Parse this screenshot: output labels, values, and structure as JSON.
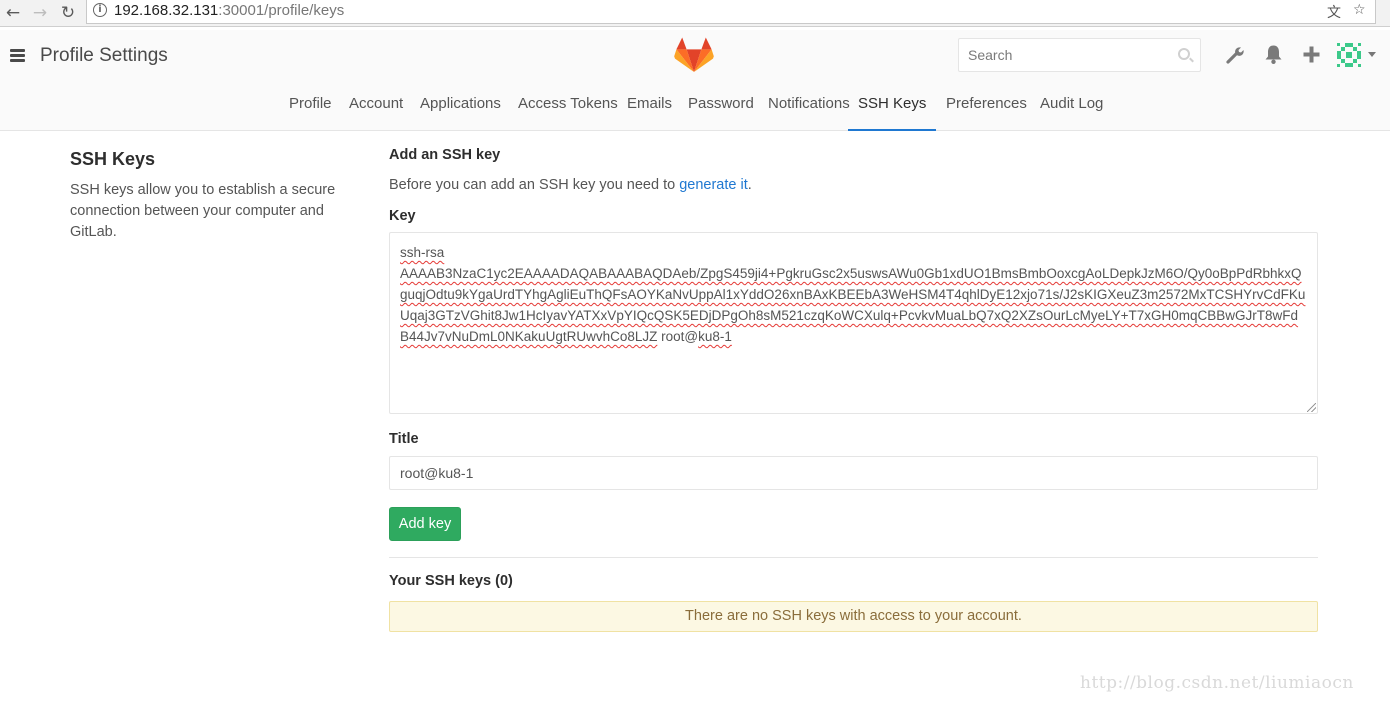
{
  "browser": {
    "url_host": "192.168.32.131",
    "url_path": ":30001/profile/keys",
    "back_icon": "arrow-left-icon",
    "forward_icon": "arrow-right-icon",
    "reload_icon": "reload-icon"
  },
  "header": {
    "title": "Profile Settings",
    "search_placeholder": "Search",
    "icons": [
      "hamburger-icon",
      "gitlab-logo",
      "search-icon",
      "wrench-icon",
      "bell-icon",
      "plus-icon",
      "avatar"
    ],
    "brand_color": "#fc6d26"
  },
  "subnav": {
    "items": [
      {
        "label": "Profile"
      },
      {
        "label": "Account"
      },
      {
        "label": "Applications"
      },
      {
        "label": "Access Tokens"
      },
      {
        "label": "Emails"
      },
      {
        "label": "Password"
      },
      {
        "label": "Notifications"
      },
      {
        "label": "SSH Keys",
        "active": true
      },
      {
        "label": "Preferences"
      },
      {
        "label": "Audit Log"
      }
    ],
    "active_color": "#1f78d1"
  },
  "sidebar": {
    "title": "SSH Keys",
    "description": "SSH keys allow you to establish a secure connection between your computer and GitLab."
  },
  "form": {
    "heading": "Add an SSH key",
    "intro_before": "Before you can add an SSH key you need to ",
    "intro_link": "generate it",
    "intro_after": ".",
    "key_label": "Key",
    "key_value": "ssh-rsa AAAAB3NzaC1yc2EAAAADAQABAAABAQDAeb/ZpgS459ji4+PgkruGsc2x5uswsAWu0Gb1xdUO1BmsBmbOoxcgAoLDepkJzM6O/Qy0oBpPdRbhkxQguqjOdtu9kYgaUrdTYhgAgliEuThQFsAOYKaNvUppAl1xYddO26xnBAxKBEEbA3WeHSM4T4qhlDyE12xjo71s/J2sKIGXeuZ3m2572MxTCSHYrvCdFKuUqaj3GTzVGhit8Jw1HcIyavYATXxVpYIQcQSK5EDjDPgOh8sM521czqKoWCXulq+PcvkvMuaLbQ7xQ2XZsOurLcMyeLY+T7xGH0mqCBBwGJrT8wFdB44Jv7vNuDmL0NKakuUgtRUwvhCo8LJZ root@ku8-1",
    "title_label": "Title",
    "title_value": "root@ku8-1",
    "submit_label": "Add key",
    "submit_color": "#2faa60"
  },
  "keys_list": {
    "heading": "Your SSH keys (0)",
    "empty_message": "There are no SSH keys with access to your account."
  },
  "watermark": "http://blog.csdn.net/liumiaocn"
}
